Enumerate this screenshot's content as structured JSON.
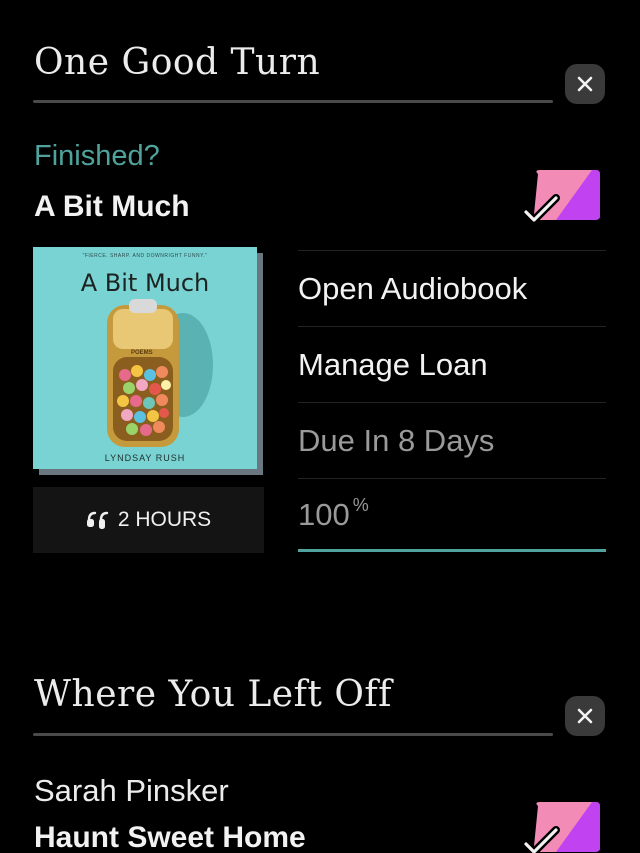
{
  "section1": {
    "title": "One Good Turn",
    "finished_label": "Finished?",
    "book_title": "A Bit Much",
    "cover": {
      "tagline": "\"FIERCE. SHARP. AND DOWNRIGHT FUNNY.\"",
      "title": "A Bit Much",
      "subtitle": "POEMS",
      "author": "LYNDSAY RUSH",
      "background_color": "#79d3d2"
    },
    "duration": {
      "icon": "headphones-icon",
      "label": "2 HOURS"
    },
    "menu": {
      "open_label": "Open Audiobook",
      "manage_label": "Manage Loan",
      "due_label": "Due In 8 Days",
      "percent_value": "100",
      "percent_symbol": "%"
    },
    "progress": 1.0
  },
  "section2": {
    "title": "Where You Left Off",
    "author": "Sarah Pinsker",
    "book_title": "Haunt Sweet Home"
  },
  "colors": {
    "accent": "#4fa39c",
    "toggle_pink": "#f28bb6",
    "toggle_purple": "#c142f0"
  }
}
